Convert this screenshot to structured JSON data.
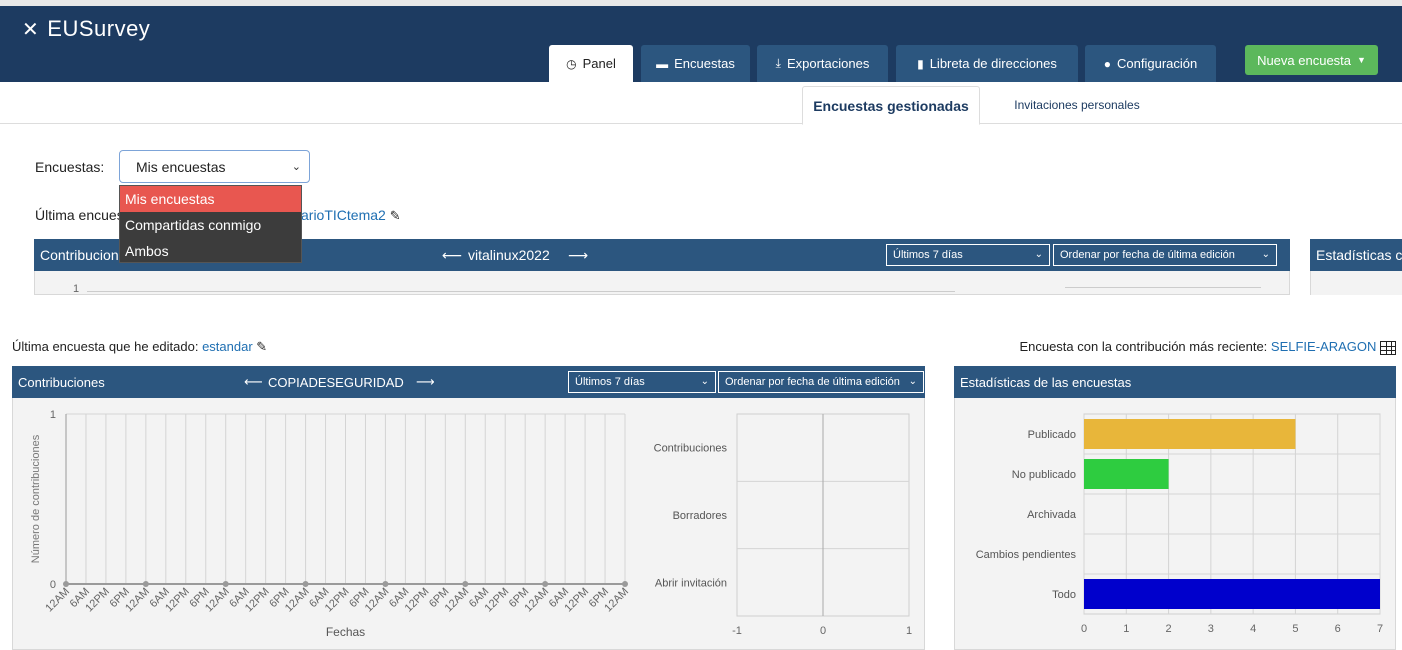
{
  "header": {
    "logo_text": "EUSurvey",
    "tabs": [
      {
        "label": "Panel",
        "icon": "dashboard-icon",
        "active": true
      },
      {
        "label": "Encuestas",
        "icon": "comment-icon",
        "active": false
      },
      {
        "label": "Exportaciones",
        "icon": "export-icon",
        "active": false
      },
      {
        "label": "Libreta de direcciones",
        "icon": "book-icon",
        "active": false
      },
      {
        "label": "Configuración",
        "icon": "user-icon",
        "active": false
      }
    ],
    "new_survey_label": "Nueva encuesta"
  },
  "subtabs": [
    {
      "label": "Encuestas gestionadas",
      "active": true
    },
    {
      "label": "Invitaciones personales",
      "active": false
    }
  ],
  "filter": {
    "label": "Encuestas:",
    "selected": "Mis encuestas",
    "options": [
      "Mis encuestas",
      "Compartidas conmigo",
      "Ambos"
    ]
  },
  "upper": {
    "last_edited_prefix": "Última encues",
    "last_edited_link": "arioTICtema2",
    "contrib_title": "Contribucion",
    "survey_name": "vitalinux2022",
    "period": "Últimos 7 días",
    "order": "Ordenar por fecha de última edición",
    "stats_title": "Estadísticas c",
    "y_tick": "1"
  },
  "lower": {
    "last_edited_prefix": "Última encuesta que he editado: ",
    "last_edited_link": "estandar",
    "recent_prefix": "Encuesta con la contribución más reciente: ",
    "recent_link": "SELFIE-ARAGON",
    "contrib_title": "Contribuciones",
    "survey_name": "COPIADESEGURIDAD",
    "period": "Últimos 7 días",
    "order": "Ordenar por fecha de última edición",
    "stats_title": "Estadísticas de las encuestas"
  },
  "chart_data": [
    {
      "type": "line",
      "xlabel": "Fechas",
      "ylabel": "Número de contribuciones",
      "ylim": [
        0,
        1
      ],
      "y_ticks": [
        "0",
        "1"
      ],
      "x_ticks": [
        "12AM",
        "6AM",
        "12PM",
        "6PM",
        "12AM",
        "6AM",
        "12PM",
        "6PM",
        "12AM",
        "6AM",
        "12PM",
        "6PM",
        "12AM",
        "6AM",
        "12PM",
        "6PM",
        "12AM",
        "6AM",
        "12PM",
        "6PM",
        "12AM",
        "6AM",
        "12PM",
        "6PM",
        "12AM",
        "6AM",
        "12PM",
        "6PM",
        "12AM"
      ],
      "values": [
        0,
        0,
        0,
        0,
        0,
        0,
        0,
        0,
        0,
        0,
        0,
        0,
        0,
        0,
        0,
        0,
        0,
        0,
        0,
        0,
        0,
        0,
        0,
        0,
        0,
        0,
        0,
        0,
        0
      ],
      "grid": true
    },
    {
      "type": "bar",
      "orientation": "horizontal",
      "categories": [
        "Contribuciones",
        "Borradores",
        "Abrir invitación"
      ],
      "values": [
        0,
        0,
        0
      ],
      "xlim": [
        -1,
        1
      ],
      "x_ticks": [
        "-1",
        "0",
        "1"
      ],
      "grid": true
    },
    {
      "type": "bar",
      "orientation": "horizontal",
      "categories": [
        "Publicado",
        "No publicado",
        "Archivada",
        "Cambios pendientes",
        "Todo"
      ],
      "values": [
        5,
        2,
        0,
        0,
        7
      ],
      "colors": [
        "#e8b63a",
        "#2ecc40",
        "#1d1dc9",
        "#1d1dc9",
        "#0000cc"
      ],
      "xlim": [
        0,
        7
      ],
      "x_ticks": [
        "0",
        "1",
        "2",
        "3",
        "4",
        "5",
        "6",
        "7"
      ],
      "grid": true
    }
  ]
}
